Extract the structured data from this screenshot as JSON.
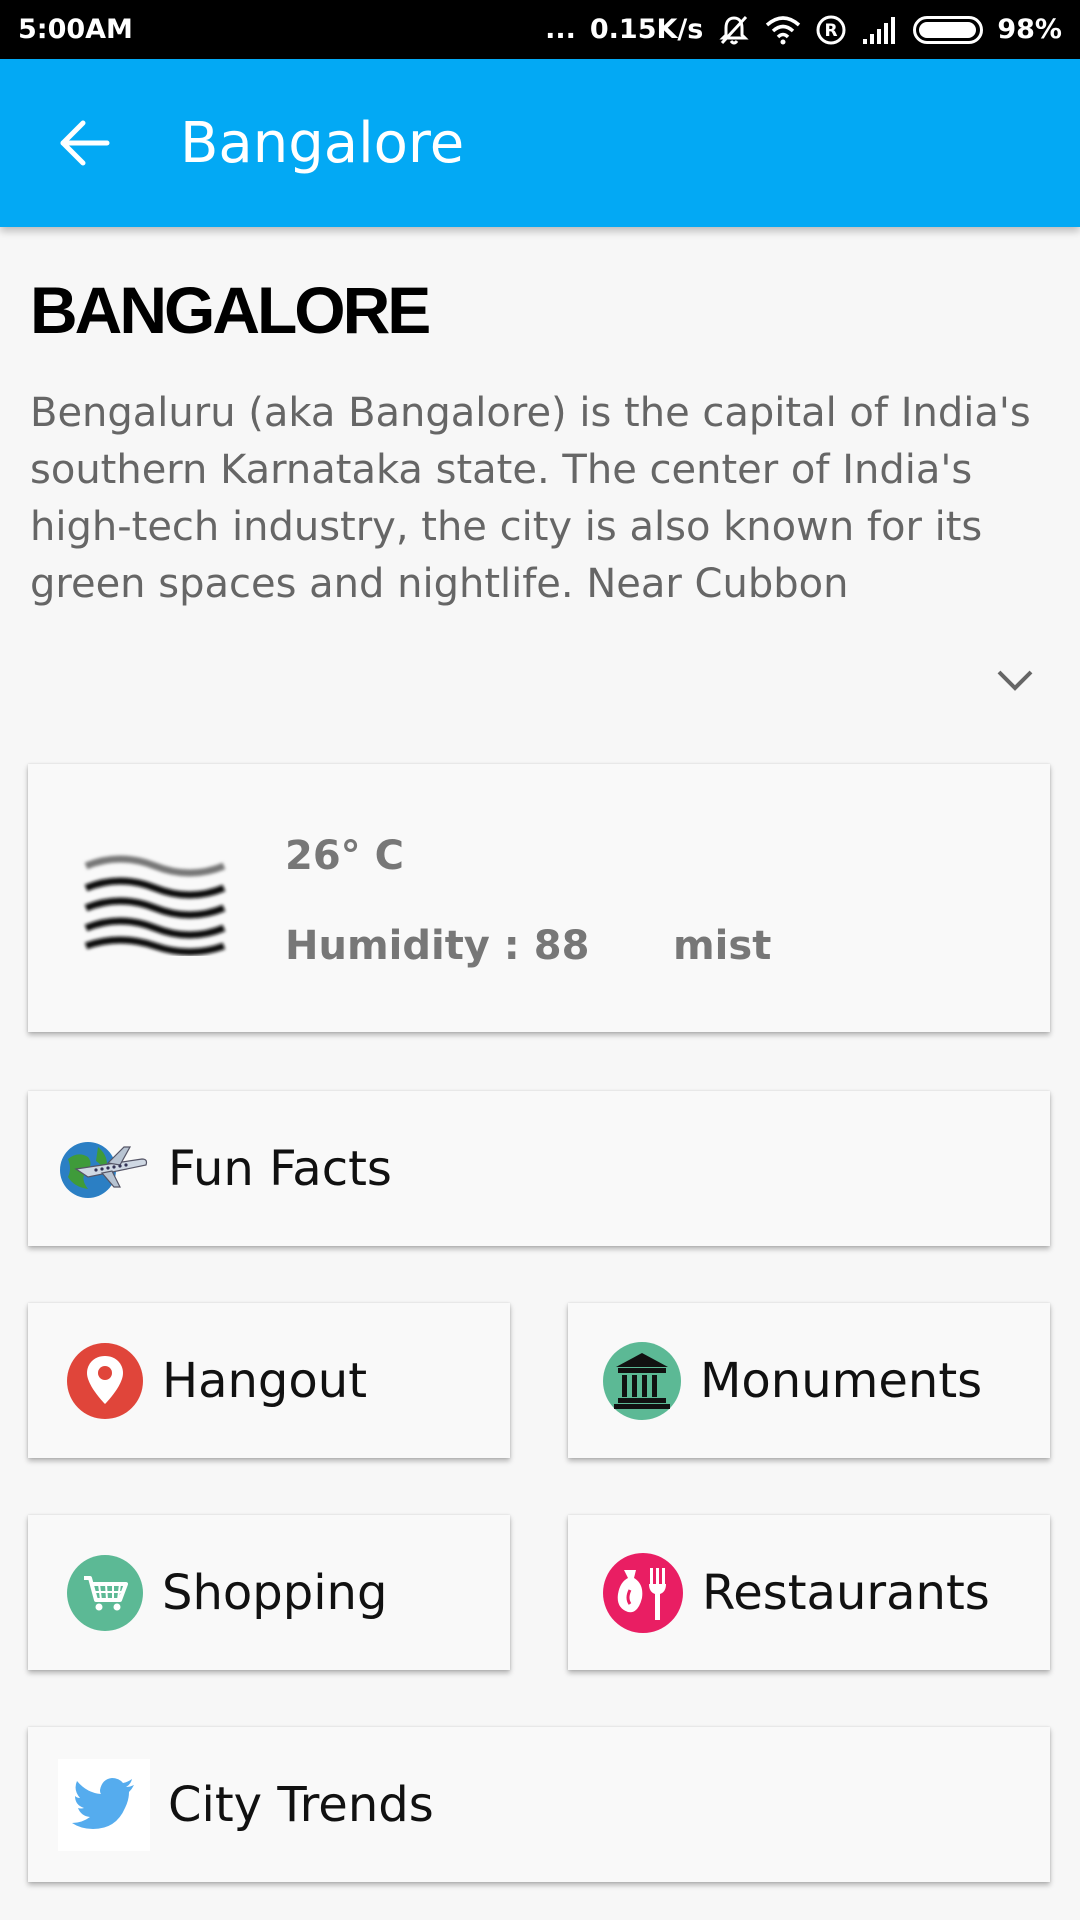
{
  "status_bar": {
    "time": "5:00AM",
    "dots": "...",
    "network_speed": "0.15K/s",
    "roaming": "R",
    "battery_percent": "98%",
    "battery_level": 0.98
  },
  "app_bar": {
    "title": "Bangalore"
  },
  "city": {
    "heading": "BANGALORE",
    "description": "Bengaluru (aka Bangalore) is the capital of India's southern Karnataka state. The center of India's high-tech industry, the city is also known for its green spaces and nightlife. Near Cubbon"
  },
  "weather": {
    "icon": "mist-icon",
    "temperature": "26° C",
    "humidity": "Humidity : 88",
    "condition": "mist"
  },
  "menu": {
    "fun_facts": {
      "label": "Fun Facts",
      "icon": "globe-airplane-icon"
    },
    "hangout": {
      "label": "Hangout",
      "icon": "map-pin-icon",
      "color": "#e0453a"
    },
    "monuments": {
      "label": "Monuments",
      "icon": "monument-icon",
      "color": "#5cb995"
    },
    "shopping": {
      "label": "Shopping",
      "icon": "shopping-cart-icon",
      "color": "#5cb995"
    },
    "restaurants": {
      "label": "Restaurants",
      "icon": "restaurant-icon",
      "color": "#e91e63"
    },
    "city_trends": {
      "label": "City Trends",
      "icon": "twitter-icon",
      "color": "#55acee"
    }
  },
  "colors": {
    "app_bar": "#03a9f4",
    "background": "#f7f7f7"
  }
}
